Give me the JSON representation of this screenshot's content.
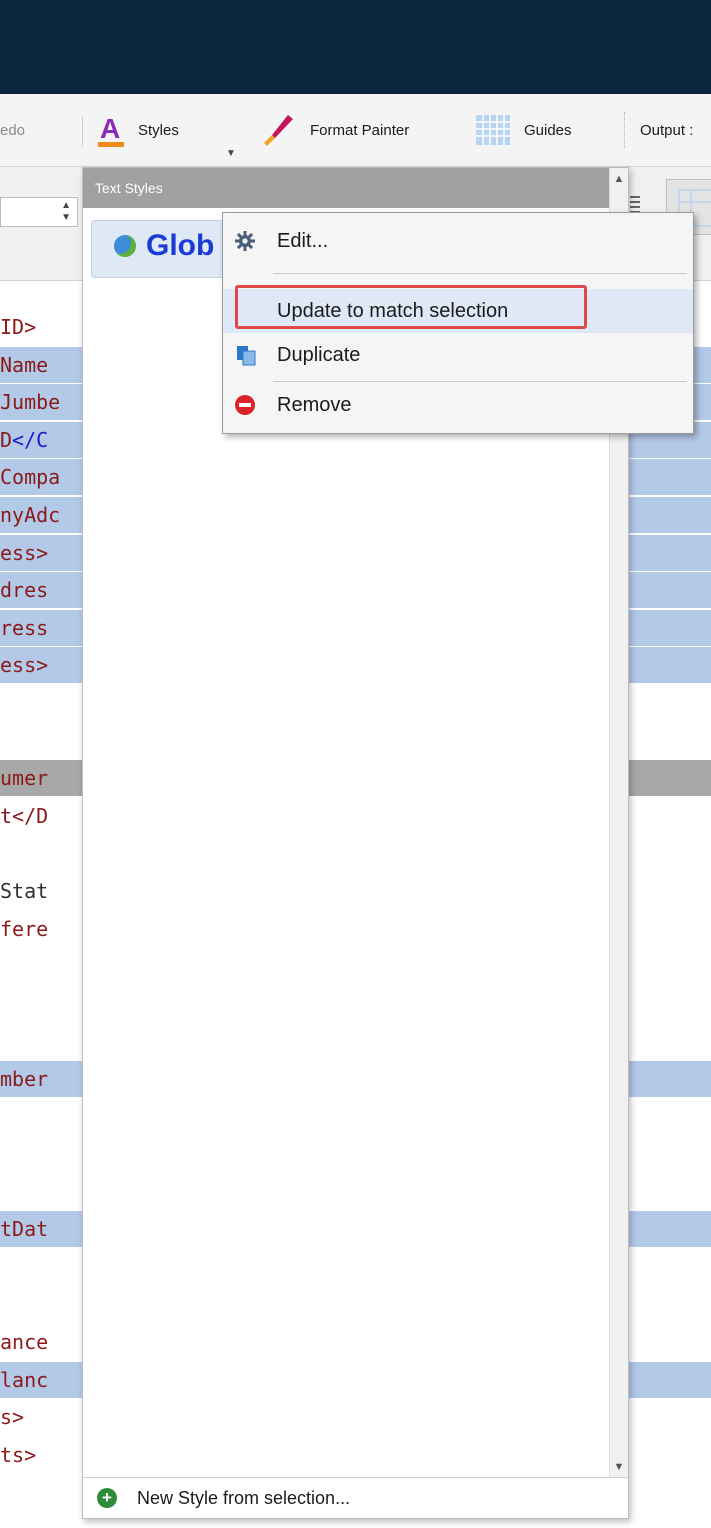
{
  "toolbar": {
    "redo_label": "edo",
    "styles_label": "Styles",
    "format_painter_label": "Format Painter",
    "guides_label": "Guides",
    "output_label": "Output :"
  },
  "editor_lines": [
    {
      "parts": [
        {
          "t": "ID>",
          "c": "tag"
        }
      ],
      "style": "plain"
    },
    {
      "parts": [
        {
          "t": "Name",
          "c": "tag"
        }
      ],
      "style": "sel"
    },
    {
      "parts": [
        {
          "t": "Jumbe",
          "c": "tag"
        }
      ],
      "style": "sel"
    },
    {
      "parts": [
        {
          "t": "D",
          "c": "tag"
        },
        {
          "t": "</C",
          "c": "blu"
        }
      ],
      "style": "sel"
    },
    {
      "parts": [
        {
          "t": "Compa",
          "c": "tag"
        }
      ],
      "style": "sel"
    },
    {
      "parts": [
        {
          "t": "nyAdc",
          "c": "tag"
        }
      ],
      "style": "sel"
    },
    {
      "parts": [
        {
          "t": "ess>",
          "c": "tag"
        }
      ],
      "style": "sel"
    },
    {
      "parts": [
        {
          "t": "dres",
          "c": "tag"
        }
      ],
      "style": "sel"
    },
    {
      "parts": [
        {
          "t": "ress",
          "c": "tag"
        }
      ],
      "style": "sel"
    },
    {
      "parts": [
        {
          "t": "ess>",
          "c": "tag"
        }
      ],
      "style": "sel"
    },
    {
      "parts": [],
      "style": "plain"
    },
    {
      "parts": [],
      "style": "plain"
    },
    {
      "parts": [
        {
          "t": "umer",
          "c": "tag"
        }
      ],
      "style": "gray"
    },
    {
      "parts": [
        {
          "t": "t</D",
          "c": "tag"
        }
      ],
      "style": "plain"
    },
    {
      "parts": [],
      "style": "plain"
    },
    {
      "parts": [
        {
          "t": "Stat",
          "c": "txt"
        }
      ],
      "style": "plain"
    },
    {
      "parts": [
        {
          "t": "fere",
          "c": "tag"
        }
      ],
      "style": "plain"
    },
    {
      "parts": [],
      "style": "plain"
    },
    {
      "parts": [],
      "style": "plain"
    },
    {
      "parts": [],
      "style": "plain"
    },
    {
      "parts": [
        {
          "t": "mber",
          "c": "tag"
        }
      ],
      "style": "sel"
    },
    {
      "parts": [],
      "style": "plain"
    },
    {
      "parts": [],
      "style": "plain"
    },
    {
      "parts": [],
      "style": "plain"
    },
    {
      "parts": [
        {
          "t": "tDat",
          "c": "tag"
        }
      ],
      "style": "sel"
    },
    {
      "parts": [],
      "style": "plain"
    },
    {
      "parts": [],
      "style": "plain"
    },
    {
      "parts": [
        {
          "t": "ance",
          "c": "tag"
        }
      ],
      "style": "plain"
    },
    {
      "parts": [
        {
          "t": "lanc",
          "c": "tag"
        }
      ],
      "style": "sel"
    },
    {
      "parts": [
        {
          "t": "s>",
          "c": "tag"
        }
      ],
      "style": "plain"
    },
    {
      "parts": [
        {
          "t": "ts>",
          "c": "tag"
        }
      ],
      "style": "plain"
    }
  ],
  "panel": {
    "title": "Text Styles",
    "style_item_label": "Glob",
    "footer_label": "New Style from selection..."
  },
  "context_menu": {
    "edit": "Edit...",
    "update": "Update to match selection",
    "duplicate": "Duplicate",
    "remove": "Remove"
  },
  "colors": {
    "titlebar": "#0d2740",
    "selection": "#b3c9e8",
    "highlight_border": "#e04747",
    "style_name": "#1a3bd6"
  }
}
